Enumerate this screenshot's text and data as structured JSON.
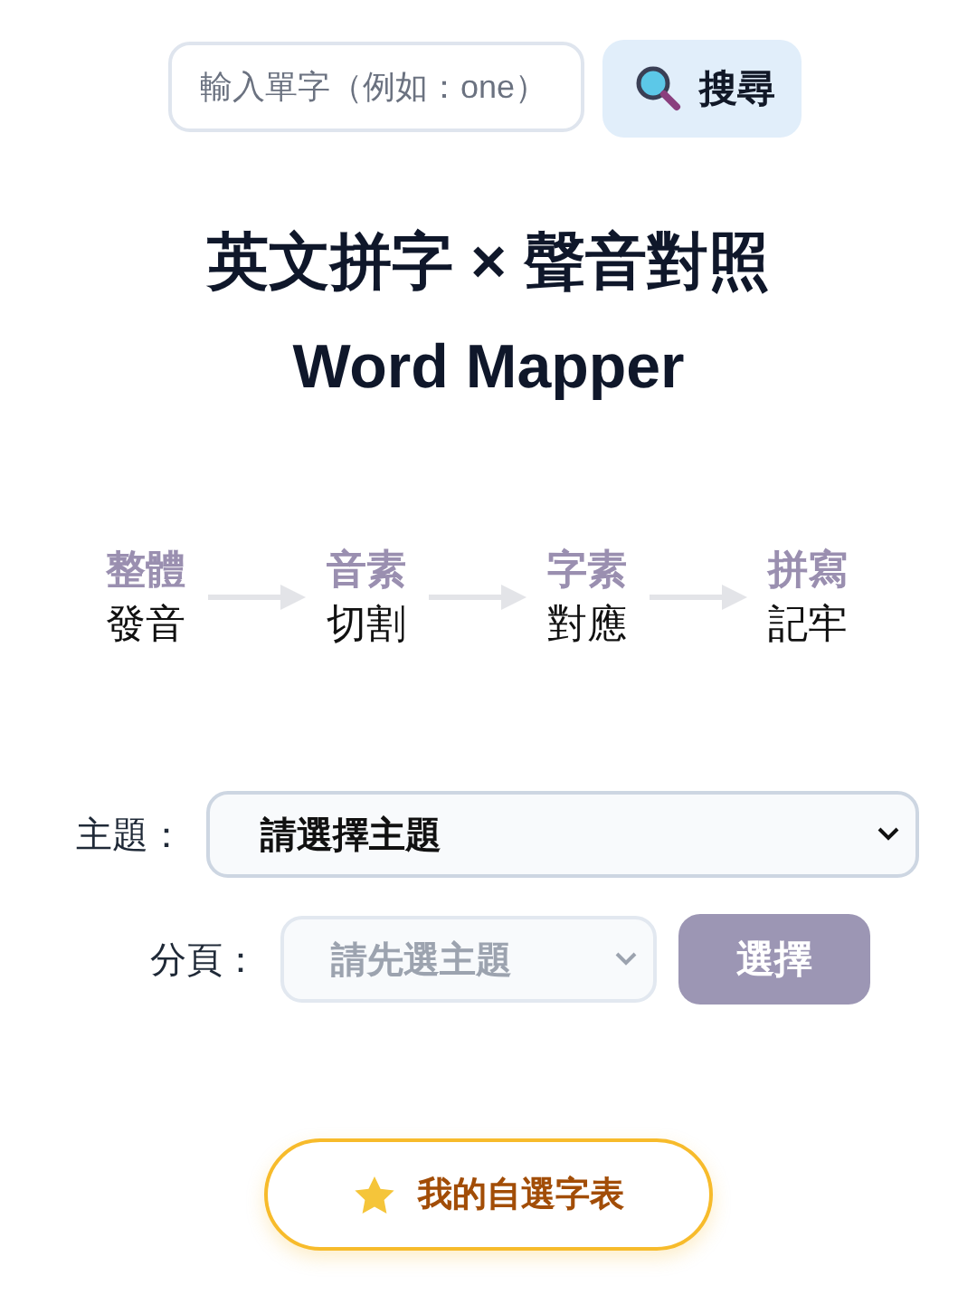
{
  "search": {
    "placeholder": "輸入單字（例如：one）",
    "button": "搜尋"
  },
  "title": [
    "英文拼字 × 聲音對照",
    "Word Mapper"
  ],
  "steps": [
    {
      "top": "整體",
      "bottom": "發音"
    },
    {
      "top": "音素",
      "bottom": "切割"
    },
    {
      "top": "字素",
      "bottom": "對應"
    },
    {
      "top": "拼寫",
      "bottom": "記牢"
    }
  ],
  "topic": {
    "label": "主題：",
    "value": "請選擇主題",
    "disabled": false
  },
  "page": {
    "label": "分頁：",
    "value": "請先選主題",
    "disabled": true
  },
  "choose_button": {
    "label": "選擇",
    "disabled": true
  },
  "favorites_button": "我的自選字表"
}
